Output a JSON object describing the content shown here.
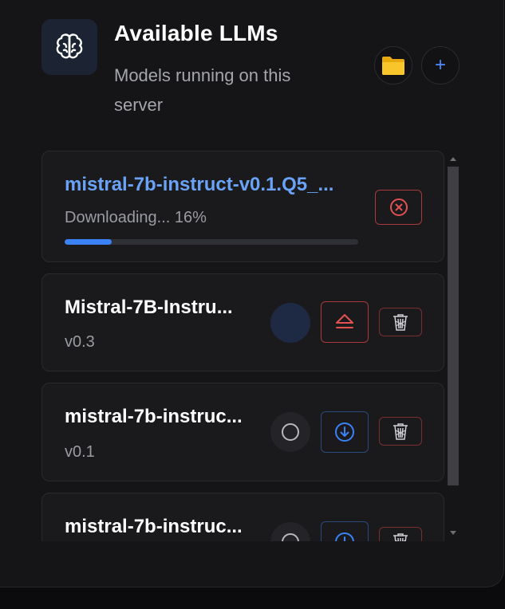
{
  "header": {
    "title": "Available LLMs",
    "subtitle": "Models running on this server",
    "brain_icon": "brain-icon",
    "folder_icon": "folder-icon",
    "add_label": "+"
  },
  "downloading": {
    "name": "mistral-7b-instruct-v0.1.Q5_...",
    "status": "Downloading... 16%",
    "progress_percent": 16,
    "cancel_icon": "cancel-circle-icon"
  },
  "models": [
    {
      "name": "Mistral-7B-Instru...",
      "version": "v0.3",
      "state": "loaded",
      "action_icon": "eject-icon"
    },
    {
      "name": "mistral-7b-instruc...",
      "version": "v0.1",
      "state": "idle",
      "action_icon": "download-icon"
    },
    {
      "name": "mistral-7b-instruc...",
      "version": "",
      "state": "idle",
      "action_icon": "download-icon"
    }
  ],
  "colors": {
    "accent_blue": "#3b82f6",
    "danger_red": "#e05252",
    "folder_yellow": "#f5c518"
  }
}
